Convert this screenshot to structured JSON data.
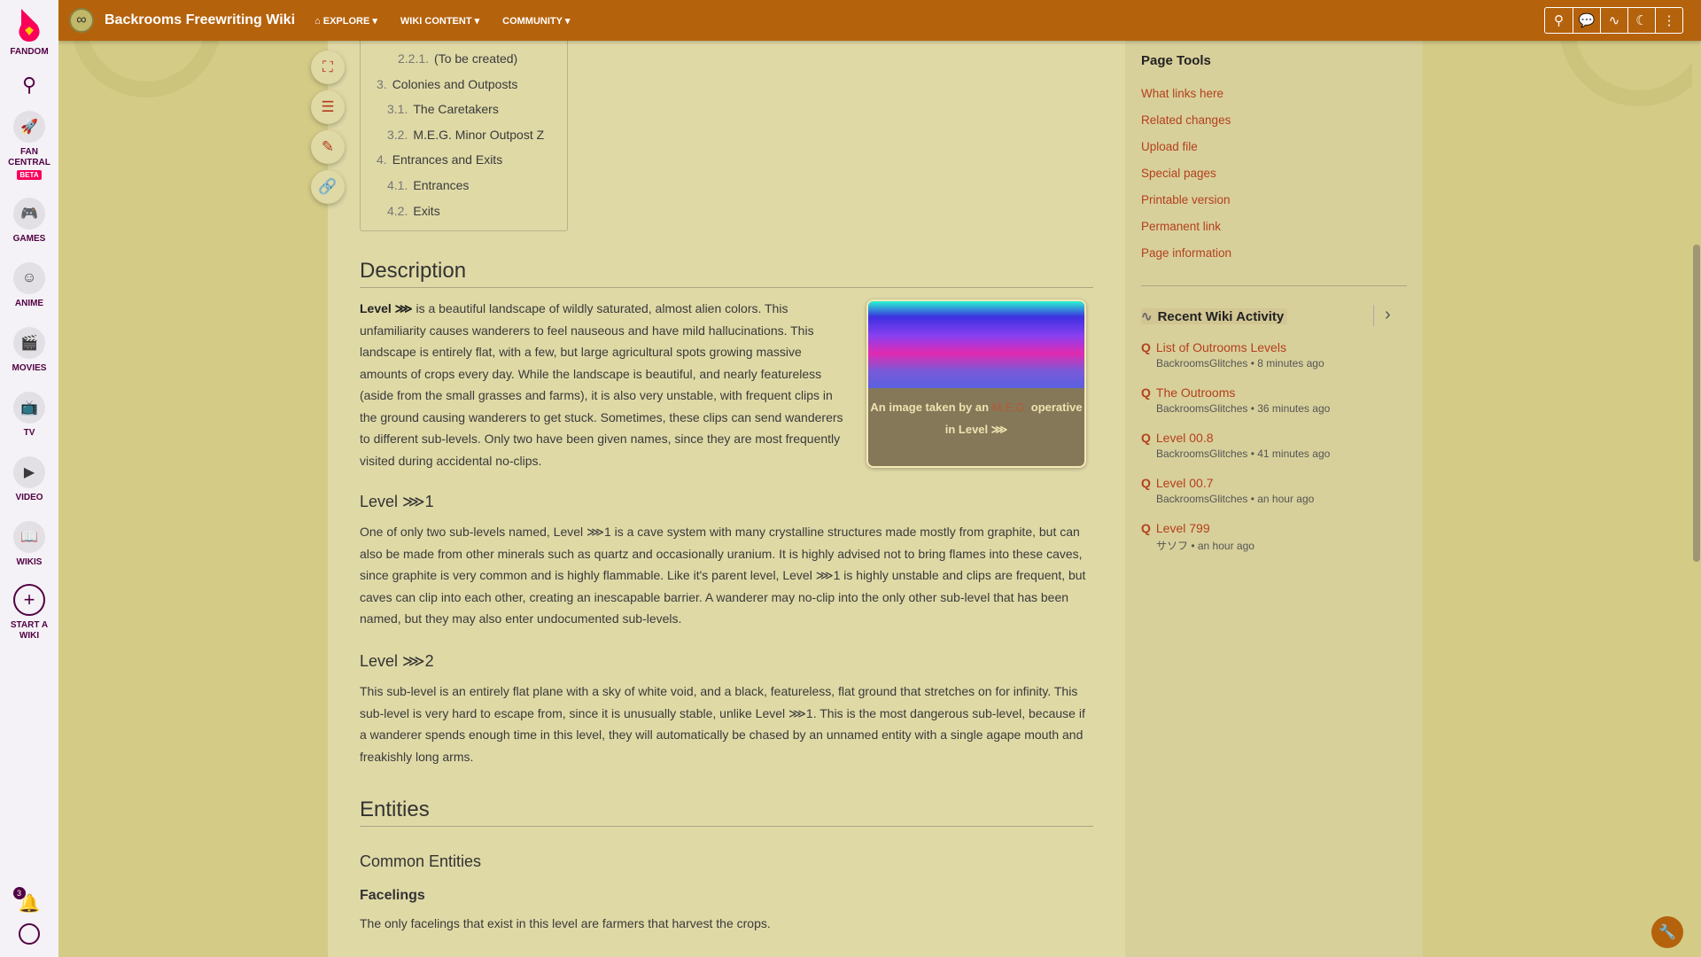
{
  "fandom_sidebar": {
    "logo": "FANDOM",
    "items": [
      {
        "label": "FAN CENTRAL",
        "badge": "BETA",
        "icon": "rocket-icon"
      },
      {
        "label": "GAMES",
        "icon": "gamepad-icon"
      },
      {
        "label": "ANIME",
        "icon": "anime-face-icon"
      },
      {
        "label": "MOVIES",
        "icon": "clapper-icon"
      },
      {
        "label": "TV",
        "icon": "tv-icon"
      },
      {
        "label": "VIDEO",
        "icon": "play-icon"
      },
      {
        "label": "WIKIS",
        "icon": "book-icon"
      },
      {
        "label": "START A WIKI",
        "icon": "plus-icon"
      }
    ],
    "notifications_count": "3"
  },
  "header": {
    "wiki_name": "Backrooms Freewriting Wiki",
    "nav": [
      "EXPLORE",
      "WIKI CONTENT",
      "COMMUNITY"
    ]
  },
  "toc": [
    {
      "n": "2.2.1.",
      "t": "(To be created)",
      "lvl": 3
    },
    {
      "n": "3.",
      "t": "Colonies and Outposts",
      "lvl": 1
    },
    {
      "n": "3.1.",
      "t": "The Caretakers",
      "lvl": 2
    },
    {
      "n": "3.2.",
      "t": "M.E.G. Minor Outpost Z",
      "lvl": 2
    },
    {
      "n": "4.",
      "t": "Entrances and Exits",
      "lvl": 1
    },
    {
      "n": "4.1.",
      "t": "Entrances",
      "lvl": 2
    },
    {
      "n": "4.2.",
      "t": "Exits",
      "lvl": 2
    }
  ],
  "article": {
    "h_description": "Description",
    "desc_bold": "Level ⋙",
    "desc_text": " is a beautiful landscape of wildly saturated, almost alien colors. This unfamiliarity causes wanderers to feel nauseous and have mild hallucinations. This landscape is entirely flat, with a few, but large agricultural spots growing massive amounts of crops every day. While the landscape is beautiful, and nearly featureless (aside from the small grasses and farms), it is also very unstable, with frequent clips in the ground causing wanderers to get stuck. Sometimes, these clips can send wanderers to different sub-levels. Only two have been given names, since they are most frequently visited during accidental no-clips.",
    "image_caption_pre": "An image taken by an ",
    "image_caption_link": "M.E.G.",
    "image_caption_post": " operative in Level ⋙",
    "h_level1": "Level ⋙1",
    "level1_text": "One of only two sub-levels named, Level ⋙1 is a cave system with many crystalline structures made mostly from graphite, but can also be made from other minerals such as quartz and occasionally uranium. It is highly advised not to bring flames into these caves, since graphite is very common and is highly flammable. Like it's parent level, Level ⋙1 is highly unstable and clips are frequent, but caves can clip into each other, creating an inescapable barrier. A wanderer may no-clip into the only other sub-level that has been named, but they may also enter undocumented sub-levels.",
    "h_level2": "Level ⋙2",
    "level2_text": "This sub-level is an entirely flat plane with a sky of white void, and a black, featureless, flat ground that stretches on for infinity. This sub-level is very hard to escape from, since it is unusually stable, unlike Level ⋙1. This is the most dangerous sub-level, because if a wanderer spends enough time in this level, they will automatically be chased by an unnamed entity with a single agape mouth and freakishly long arms.",
    "h_entities": "Entities",
    "h_common": "Common Entities",
    "h_facelings": "Facelings",
    "facelings_text": "The only facelings that exist in this level are farmers that harvest the crops."
  },
  "rail": {
    "page_tools_title": "Page Tools",
    "page_tools": [
      "What links here",
      "Related changes",
      "Upload file",
      "Special pages",
      "Printable version",
      "Permanent link",
      "Page information"
    ],
    "activity_title": "Recent Wiki Activity",
    "activity": [
      {
        "title": "List of Outrooms Levels",
        "meta": "BackroomsGlitches • 8 minutes ago"
      },
      {
        "title": "The Outrooms",
        "meta": "BackroomsGlitches • 36 minutes ago"
      },
      {
        "title": "Level 00.8",
        "meta": "BackroomsGlitches • 41 minutes ago"
      },
      {
        "title": "Level 00.7",
        "meta": "BackroomsGlitches • an hour ago"
      },
      {
        "title": "Level 799",
        "meta": "サソフ • an hour ago"
      }
    ]
  },
  "colors": {
    "topbar": "#b5620c",
    "link": "#b3401e",
    "content_bg": "#dfd9a6",
    "page_bg": "#d4cb86"
  }
}
